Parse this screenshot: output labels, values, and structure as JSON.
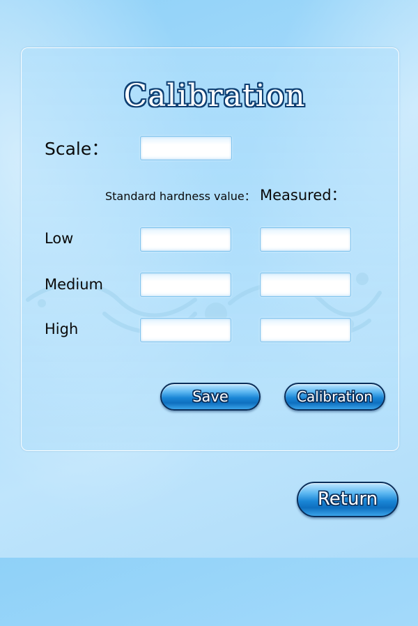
{
  "title": "Calibration",
  "labels": {
    "scale": "Scale：",
    "standard_hardness_value": "Standard hardness value：",
    "measured": "Measured：",
    "low": "Low",
    "medium": "Medium",
    "high": "High"
  },
  "fields": {
    "scale": "",
    "low_standard": "",
    "low_measured": "",
    "medium_standard": "",
    "medium_measured": "",
    "high_standard": "",
    "high_measured": ""
  },
  "buttons": {
    "save": "Save",
    "calibration": "Calibration",
    "return": "Return"
  },
  "colors": {
    "background": "#a9dcfb",
    "button_fill": "#1a86d6",
    "button_outline": "#0b2f5a",
    "title_outline": "#0e3f72"
  },
  "icons": {
    "ornament": "floral-swirl-ornament"
  }
}
